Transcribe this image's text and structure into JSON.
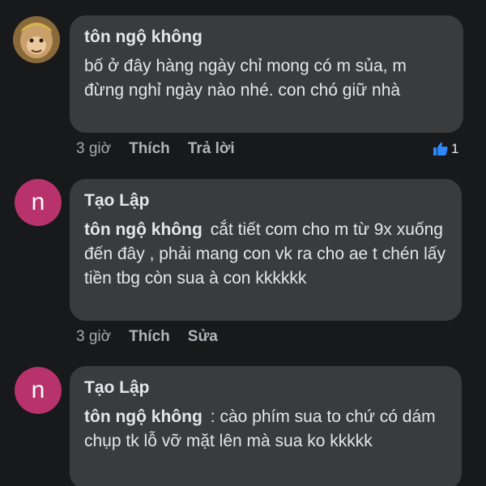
{
  "comments": [
    {
      "author": "tôn ngộ không",
      "text": "bố ở đây hàng ngày chỉ mong có m sủa, m đừng nghỉ ngày nào nhé. con chó giữ nhà",
      "time": "3 giờ",
      "like_label": "Thích",
      "second_action": "Trả lời",
      "reaction_count": "1"
    },
    {
      "author": "Tạo Lập",
      "avatar_letter": "n",
      "mention": "tôn ngộ không",
      "text": "cắt tiết com cho m từ 9x xuống đến đây , phải mang con vk ra cho ae t chén lấy tiền tbg còn sua à con kkkkkk",
      "time": "3 giờ",
      "like_label": "Thích",
      "second_action": "Sửa"
    },
    {
      "author": "Tạo Lập",
      "avatar_letter": "n",
      "mention": "tôn ngộ không",
      "text": ": cào phím sua to chứ có dám chụp tk lỗ vỡ mặt lên mà sua ko kkkkk"
    }
  ],
  "colors": {
    "background": "#18191a",
    "bubble": "#3a3b3c",
    "avatar_letter_bg": "#b8326b",
    "like_blue": "#2d88ff"
  }
}
